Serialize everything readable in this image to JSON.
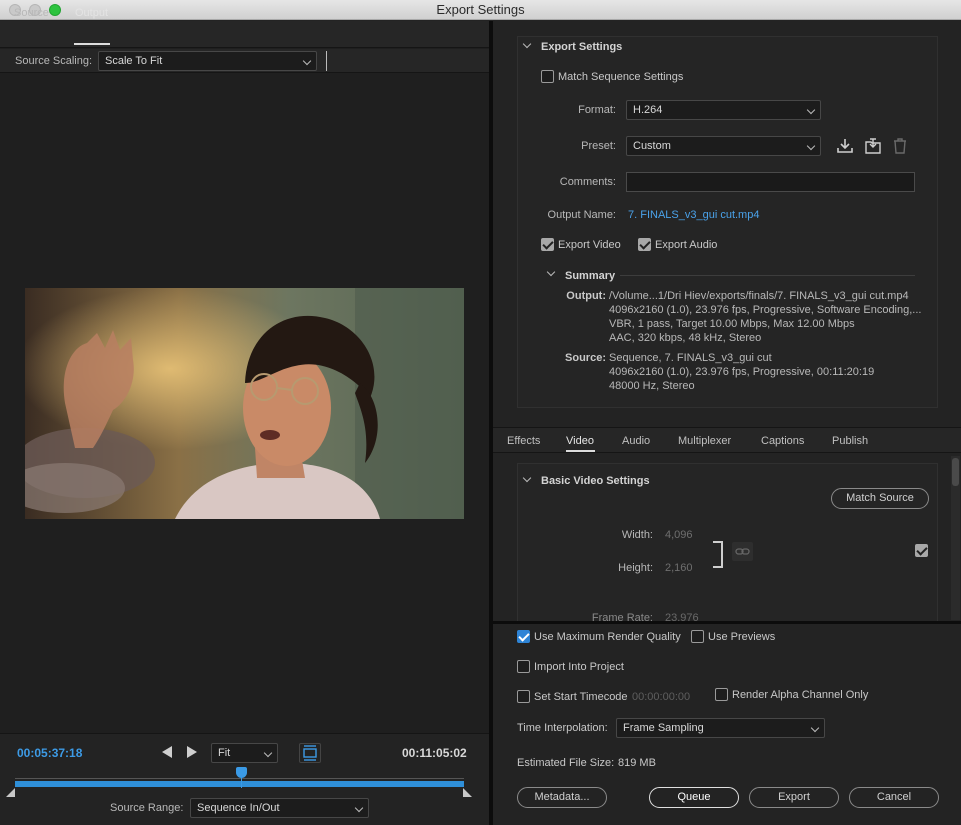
{
  "window": {
    "title": "Export Settings"
  },
  "left": {
    "tabs": [
      {
        "label": "Source"
      },
      {
        "label": "Output"
      }
    ],
    "scaling_label": "Source Scaling:",
    "scaling_value": "Scale To Fit",
    "timecode_in": "00:05:37:18",
    "timecode_out": "00:11:05:02",
    "fit_value": "Fit",
    "source_range_label": "Source Range:",
    "source_range_value": "Sequence In/Out"
  },
  "export_settings": {
    "header": "Export Settings",
    "match_sequence_label": "Match Sequence Settings",
    "format_label": "Format:",
    "format_value": "H.264",
    "preset_label": "Preset:",
    "preset_value": "Custom",
    "comments_label": "Comments:",
    "comments_value": "",
    "output_name_label": "Output Name:",
    "output_name_value": "7. FINALS_v3_gui cut.mp4",
    "export_video_label": "Export Video",
    "export_audio_label": "Export Audio",
    "summary_header": "Summary",
    "summary_output_label": "Output:",
    "summary_output_lines": [
      "/Volume...1/Dri Hiev/exports/finals/7. FINALS_v3_gui cut.mp4",
      "4096x2160 (1.0), 23.976 fps, Progressive, Software Encoding,...",
      "VBR, 1 pass, Target 10.00 Mbps, Max 12.00 Mbps",
      "AAC, 320 kbps, 48 kHz, Stereo"
    ],
    "summary_source_label": "Source:",
    "summary_source_lines": [
      "Sequence, 7. FINALS_v3_gui cut",
      "4096x2160 (1.0), 23.976 fps, Progressive, 00:11:20:19",
      "48000 Hz, Stereo"
    ]
  },
  "tabs": [
    {
      "label": "Effects"
    },
    {
      "label": "Video"
    },
    {
      "label": "Audio"
    },
    {
      "label": "Multiplexer"
    },
    {
      "label": "Captions"
    },
    {
      "label": "Publish"
    }
  ],
  "video": {
    "header": "Basic Video Settings",
    "match_source_label": "Match Source",
    "width_label": "Width:",
    "width_value": "4,096",
    "height_label": "Height:",
    "height_value": "2,160",
    "frame_rate_label": "Frame Rate:",
    "frame_rate_value": "23.976"
  },
  "bottom": {
    "max_quality_label": "Use Maximum Render Quality",
    "previews_label": "Use Previews",
    "import_label": "Import Into Project",
    "start_tc_label": "Set Start Timecode",
    "start_tc_value": "00:00:00:00",
    "alpha_label": "Render Alpha Channel Only",
    "interp_label": "Time Interpolation:",
    "interp_value": "Frame Sampling",
    "filesize_label": "Estimated File Size:",
    "filesize_value": "819 MB",
    "metadata_label": "Metadata...",
    "queue_label": "Queue",
    "export_label": "Export",
    "cancel_label": "Cancel"
  },
  "colors": {
    "accent": "#3d9be6",
    "link": "#4aa2ea",
    "panel": "#232323",
    "checkbox_on": "#2e84d6"
  }
}
